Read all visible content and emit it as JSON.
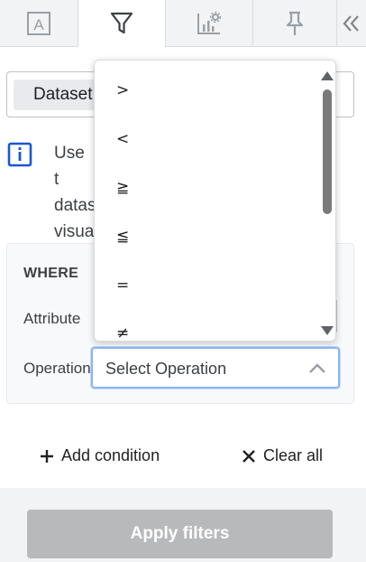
{
  "tabs": [
    {
      "name": "text",
      "icon": "text-box-icon",
      "active": false
    },
    {
      "name": "filter",
      "icon": "filter-icon",
      "active": true
    },
    {
      "name": "chart-settings",
      "icon": "chart-settings-icon",
      "active": false
    },
    {
      "name": "pin",
      "icon": "pin-icon",
      "active": false
    },
    {
      "name": "collapse",
      "icon": "double-chevron-left-icon",
      "active": false
    }
  ],
  "dataset": {
    "label": "Dataset"
  },
  "info": {
    "text": "Use t datas visua"
  },
  "where": {
    "title": "WHERE",
    "attribute_label": "Attribute",
    "operation_label": "Operation",
    "operation_placeholder": "Select Operation"
  },
  "dropdown": {
    "options": [
      ">",
      "<",
      "≧",
      "≦",
      "=",
      "≠"
    ]
  },
  "actions": {
    "add_condition": "Add condition",
    "clear_all": "Clear all"
  },
  "apply_label": "Apply filters",
  "colors": {
    "focus": "#8ab4f8",
    "info_icon": "#1a56d6",
    "apply_disabled": "#b8b9bb"
  }
}
